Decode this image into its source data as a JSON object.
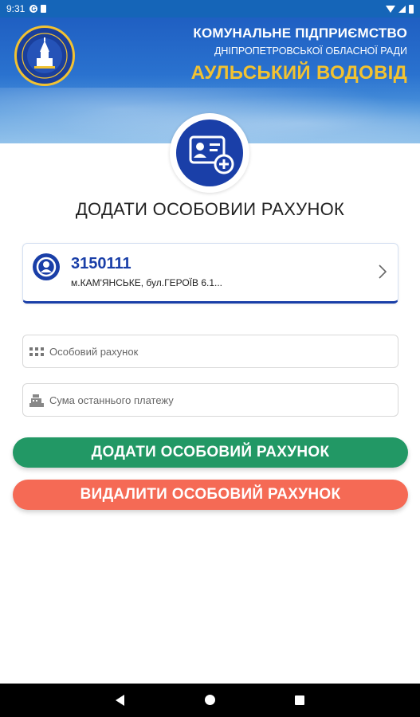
{
  "status_bar": {
    "time": "9:31",
    "icons_left": [
      "google-icon",
      "sd-card-icon"
    ],
    "icons_right": [
      "wifi-icon",
      "signal-icon",
      "battery-icon"
    ]
  },
  "header": {
    "org_line1": "КОМУНАЛЬНЕ ПІДПРИЄМСТВО",
    "org_line2": "ДНІПРОПЕТРОВСЬКОЇ ОБЛАСНОЇ РАДИ",
    "org_line3": "АУЛЬСЬКИЙ ВОДОВІД",
    "logo_icon": "water-tower-logo",
    "colors": {
      "header_blue": "#1f5fc2",
      "accent_yellow": "#f2c231"
    }
  },
  "badge_icon": "id-card-add-icon",
  "page": {
    "title": "ДОДАТИ ОСОБОВИИ РАХУНОК"
  },
  "account": {
    "number": "3150111",
    "address": "м.КАМ'ЯНСЬКЕ, бул.ГЕРОЇВ 6.1..."
  },
  "form": {
    "account_field": {
      "placeholder": "Особовий рахунок",
      "value": ""
    },
    "sum_field": {
      "placeholder": "Сума останнього платежу",
      "value": ""
    }
  },
  "buttons": {
    "add_label": "ДОДАТИ ОСОБОВИЙ РАХУНОК",
    "delete_label": "ВИДАЛИТИ ОСОБОВИЙ РАХУНОК",
    "add_color": "#229865",
    "delete_color": "#f56a55"
  },
  "nav_bar": {
    "icons": [
      "back-icon",
      "home-icon",
      "recents-icon"
    ]
  }
}
